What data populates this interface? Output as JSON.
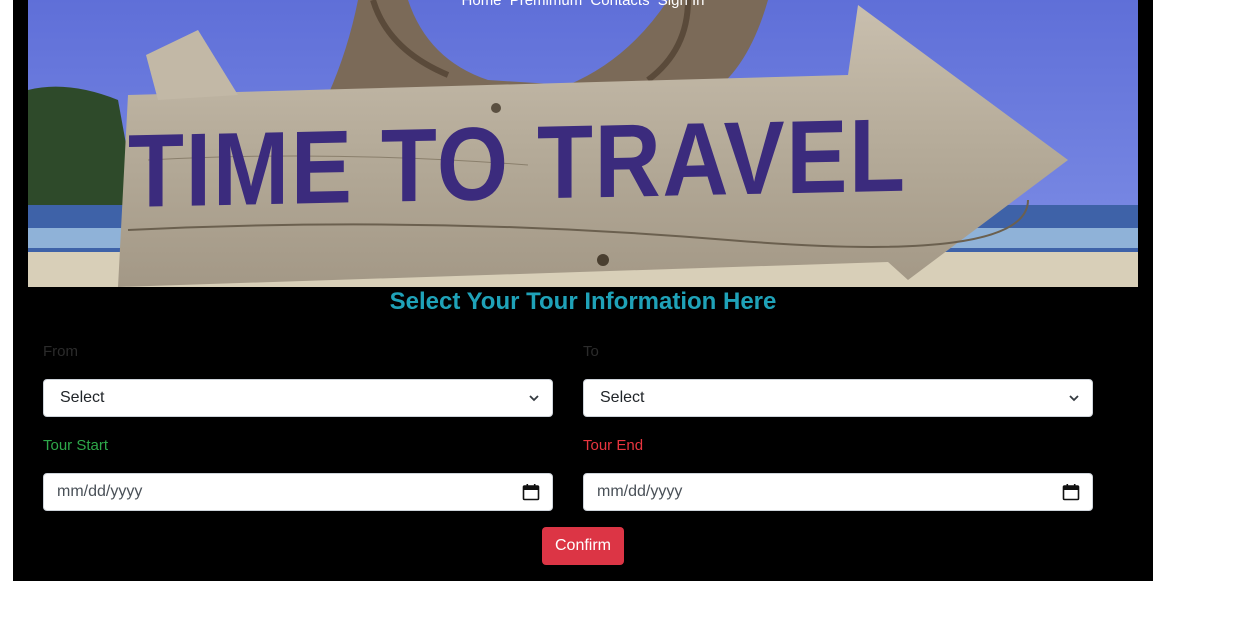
{
  "nav": {
    "items": [
      {
        "label": "Home"
      },
      {
        "label": "Premimum"
      },
      {
        "label": "Contacts"
      },
      {
        "label": "Sign In"
      }
    ]
  },
  "hero": {
    "sign_text": "TIME TO TRAVEL"
  },
  "form": {
    "title": "Select Your Tour Information Here",
    "from": {
      "label": "From",
      "value": "Select"
    },
    "to": {
      "label": "To",
      "value": "Select"
    },
    "tour_start": {
      "label": "Tour Start",
      "value": "mm/dd/yyyy"
    },
    "tour_end": {
      "label": "Tour End",
      "value": "mm/dd/yyyy"
    },
    "confirm_label": "Confirm"
  },
  "colors": {
    "title": "#1fa2b8",
    "tour_start_label": "#2ea84a",
    "tour_end_label": "#e8353f",
    "confirm_button": "#dc3545"
  }
}
